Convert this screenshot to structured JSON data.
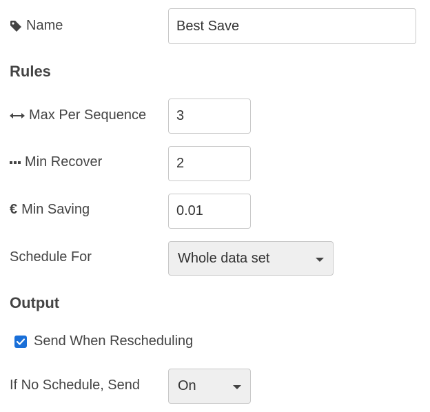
{
  "name_field": {
    "label": "Name",
    "value": "Best Save",
    "icon": "tag-icon"
  },
  "rules": {
    "title": "Rules",
    "max_per_sequence": {
      "label": "Max Per Sequence",
      "value": "3",
      "icon": "horizontal-arrows-icon"
    },
    "min_recover": {
      "label": "Min Recover",
      "value": "2",
      "icon": "ellipsis-icon"
    },
    "min_saving": {
      "label": "Min Saving",
      "value": "0.01",
      "icon": "euro-icon",
      "icon_glyph": "€"
    },
    "schedule_for": {
      "label": "Schedule For",
      "selected": "Whole data set"
    }
  },
  "output": {
    "title": "Output",
    "send_when_rescheduling": {
      "label": "Send When Rescheduling",
      "checked": true
    },
    "if_no_schedule_send": {
      "label": "If No Schedule, Send",
      "selected": "On"
    }
  },
  "colors": {
    "accent": "#1a6fd8",
    "text": "#444444",
    "select_bg": "#efefef"
  }
}
